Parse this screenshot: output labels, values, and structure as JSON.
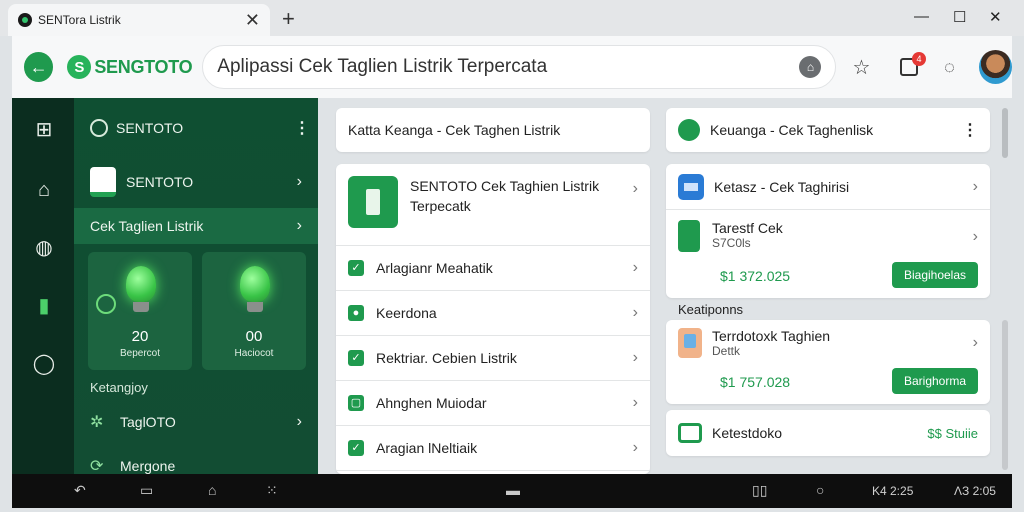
{
  "tab": {
    "title": "SENTora Listrik"
  },
  "window": {
    "new_tab": "+",
    "minimize": "—",
    "maximize": "☐",
    "close": "✕",
    "tab_close": "✕"
  },
  "address": {
    "brand": "SENGTOTO",
    "url": "Aplipassi Cek Taglien Listrik Terpercata",
    "ext_badge": "4"
  },
  "sidebar": {
    "title": "SENTOTO",
    "items": [
      {
        "label": "SENTOTO"
      },
      {
        "label": "Cek Taglien Listrik"
      }
    ],
    "cards": [
      {
        "value": "20",
        "label": "Bepercot"
      },
      {
        "value": "00",
        "label": "Haciocot"
      }
    ],
    "section": "Ketangjoy",
    "bottom_items": [
      {
        "label": "TaglOTO"
      },
      {
        "label": "Mergone"
      }
    ]
  },
  "middle": {
    "top_label": "Katta Keanga - Cek Taghen Listrik",
    "featured": "SENTOTO Cek Taghien Listrik Terpecatk",
    "rows": [
      {
        "label": "Arlagianr Meahatik"
      },
      {
        "label": "Keerdona"
      },
      {
        "label": "Rektriar. Cebien Listrik"
      },
      {
        "label": "Ahnghen Muiodar"
      },
      {
        "label": "Aragian lNeltiaik"
      }
    ]
  },
  "right": {
    "top_label": "Keuanga - Cek Taghenlisk",
    "row1": "Ketasz - Cek Taghirisi",
    "row2_title": "Tarestf Cek",
    "row2_sub": "S7C0ls",
    "row2_amount": "$1 372.025",
    "row2_button": "Biagihoelas",
    "section": "Keatiponns",
    "row3_title": "Terrdotoxk Taghien",
    "row3_sub": "Dettk",
    "row3_amount": "$1 757.028",
    "row3_button": "Barighorma",
    "row4_title": "Ketestdoko",
    "row4_value": "$$ Stuiie"
  },
  "navbar": {
    "time": "K4 2:25",
    "status": "ΛЗ 2:05"
  }
}
